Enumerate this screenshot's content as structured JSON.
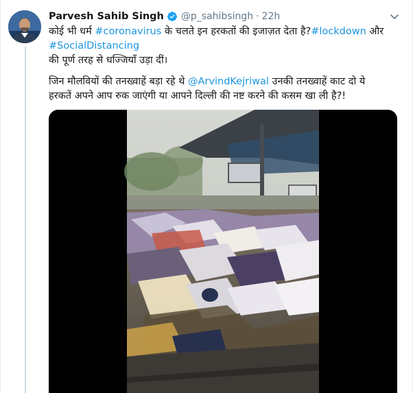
{
  "tweet": {
    "display_name": "Parvesh Sahib Singh",
    "handle": "@p_sahibsingh",
    "separator": "·",
    "time": "22h",
    "line1_a": "कोई भी धर्म ",
    "line1_tag1": "#coronavirus",
    "line1_b": " के चलते इन हरकतों की इजाज़त देता है?",
    "line1_tag2": "#lockdown",
    "line1_c": " और",
    "line2_tag": "#SocialDistancing",
    "line3": "की पूर्ण तरह से धज्जियाँ उड़ा दीं।",
    "line4_a": "जिन मौलवियों की तनख्वाहें बड़ा रहे थे ",
    "line4_mention": "@ArvindKejriwal",
    "line4_b": " उनकी तनख्वाहें काट दो ये",
    "line5": "हरकतें अपने आप रुक जाएंगी या आपने दिल्ली की नष्ट करने की कसम खा ली है?!"
  },
  "icons": {
    "verified": "verified-badge-icon",
    "caret": "chevron-down-icon"
  },
  "colors": {
    "link": "#1b95e0",
    "secondary_text": "#657786",
    "verified": "#1da1f2",
    "thread_line": "#ccd6dd"
  }
}
